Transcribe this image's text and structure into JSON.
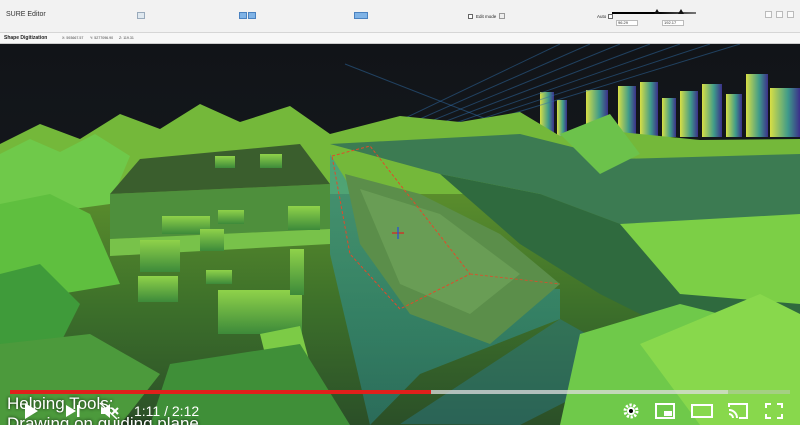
{
  "app": {
    "title": "SURE Editor",
    "edit_mode_label": "Edit mode",
    "edit_mode_value": "",
    "auto_label": "Auto",
    "range_min_value": "96.29",
    "range_max_value": "192.17"
  },
  "toolbar": {
    "section_title": "Shape Digitization",
    "coord_x": "X: 593667.57",
    "coord_y": "Y: 5277096.90",
    "coord_z": "Z: 119.31"
  },
  "video": {
    "caption_line1": "Helping Tools:",
    "caption_line2": "Drawing on guiding plane",
    "time_current": "1:11",
    "time_separator": " / ",
    "time_total": "2:12",
    "played_fraction": 0.54,
    "loaded_fraction": 0.92,
    "accent_color": "#e0201b"
  },
  "icons": {
    "play": "play-icon",
    "next": "next-icon",
    "mute": "volume-muted-icon",
    "settings": "gear-icon",
    "miniplayer": "miniplayer-icon",
    "theater": "theater-mode-icon",
    "cast": "cast-icon",
    "fullscreen": "fullscreen-icon"
  }
}
